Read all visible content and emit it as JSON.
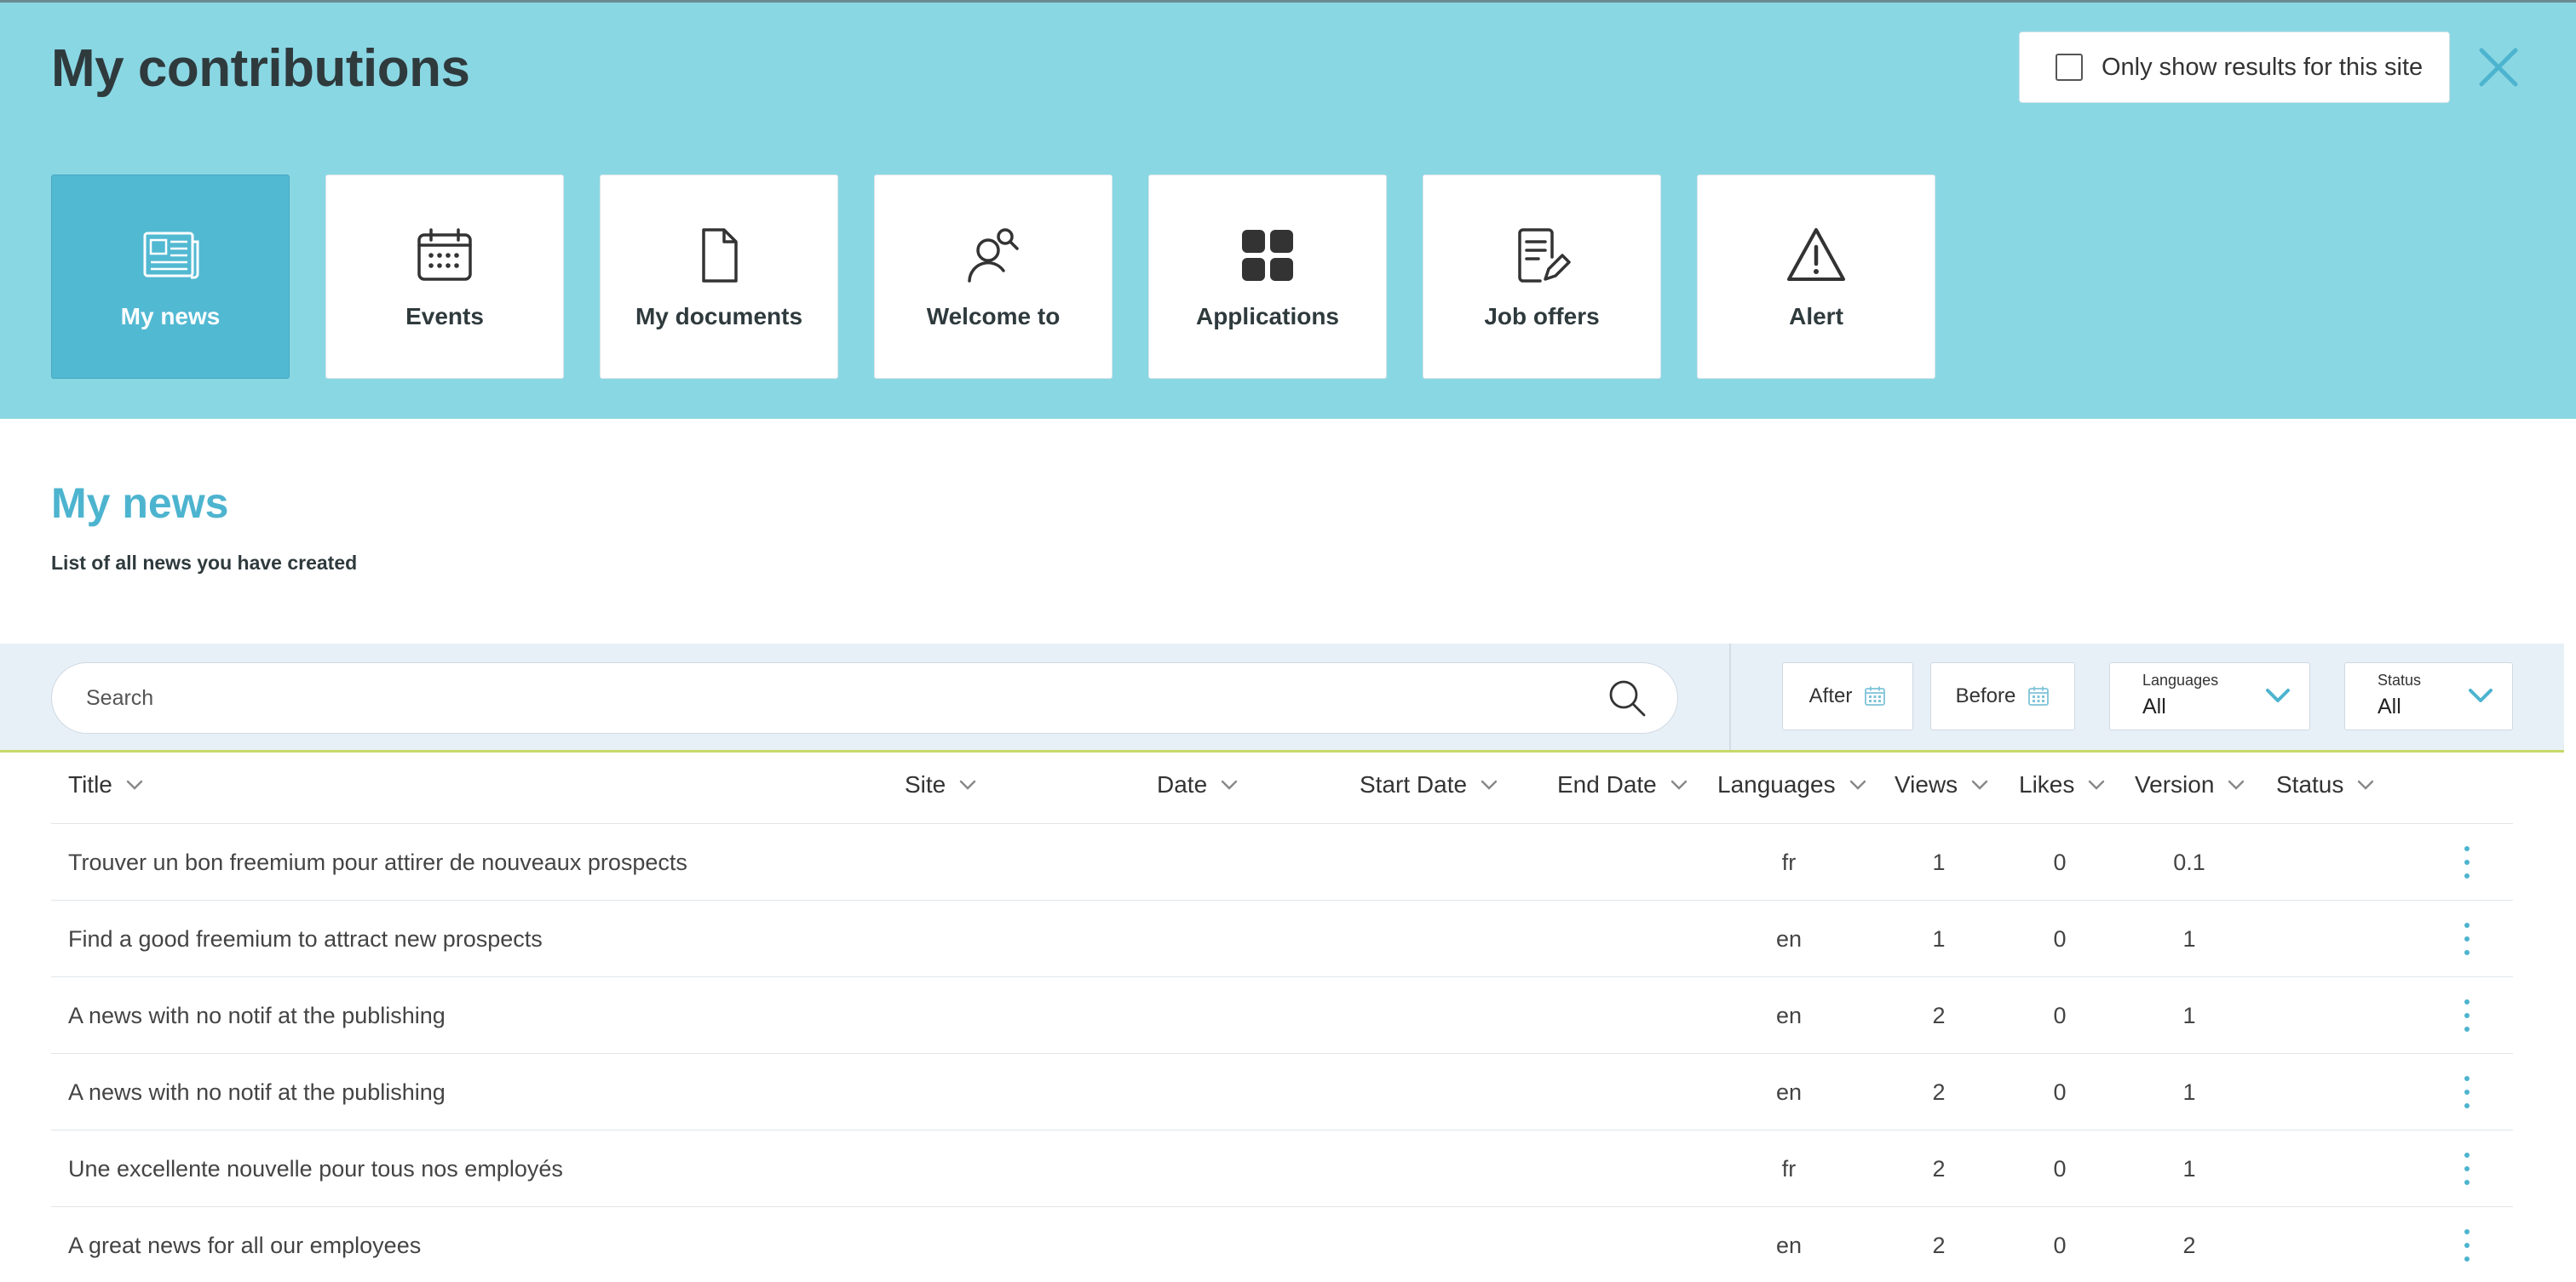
{
  "header": {
    "title": "My contributions",
    "site_filter_label": "Only show results for this site"
  },
  "tiles": [
    {
      "label": "My news",
      "icon": "newspaper-icon",
      "active": true
    },
    {
      "label": "Events",
      "icon": "calendar-icon",
      "active": false
    },
    {
      "label": "My documents",
      "icon": "document-icon",
      "active": false
    },
    {
      "label": "Welcome to",
      "icon": "user-search-icon",
      "active": false
    },
    {
      "label": "Applications",
      "icon": "grid-icon",
      "active": false
    },
    {
      "label": "Job offers",
      "icon": "edit-document-icon",
      "active": false
    },
    {
      "label": "Alert",
      "icon": "warning-icon",
      "active": false
    }
  ],
  "section": {
    "title": "My news",
    "subtitle": "List of all news you have created"
  },
  "filters": {
    "search_placeholder": "Search",
    "after_label": "After",
    "before_label": "Before",
    "languages_label": "Languages",
    "languages_value": "All",
    "status_label": "Status",
    "status_value": "All"
  },
  "table": {
    "columns": [
      "Title",
      "Site",
      "Date",
      "Start Date",
      "End Date",
      "Languages",
      "Views",
      "Likes",
      "Version",
      "Status"
    ],
    "rows": [
      {
        "title": "Trouver un bon freemium pour attirer de nouveaux prospects",
        "language": "fr",
        "views": "1",
        "likes": "0",
        "version": "0.1"
      },
      {
        "title": "Find a good freemium to attract new prospects",
        "language": "en",
        "views": "1",
        "likes": "0",
        "version": "1"
      },
      {
        "title": "A news with no notif at the publishing",
        "language": "en",
        "views": "2",
        "likes": "0",
        "version": "1"
      },
      {
        "title": "A news with no notif at the publishing",
        "language": "en",
        "views": "2",
        "likes": "0",
        "version": "1"
      },
      {
        "title": "Une excellente nouvelle pour tous nos employés",
        "language": "fr",
        "views": "2",
        "likes": "0",
        "version": "1"
      },
      {
        "title": "A great news for all our employees",
        "language": "en",
        "views": "2",
        "likes": "0",
        "version": "2"
      }
    ]
  },
  "colors": {
    "header_bg": "#8ad7e4",
    "accent": "#52b9d2",
    "title_accent": "#4db4cf",
    "filter_bar_bg": "#e8f0f7",
    "divider_accent": "#c6d96a"
  }
}
